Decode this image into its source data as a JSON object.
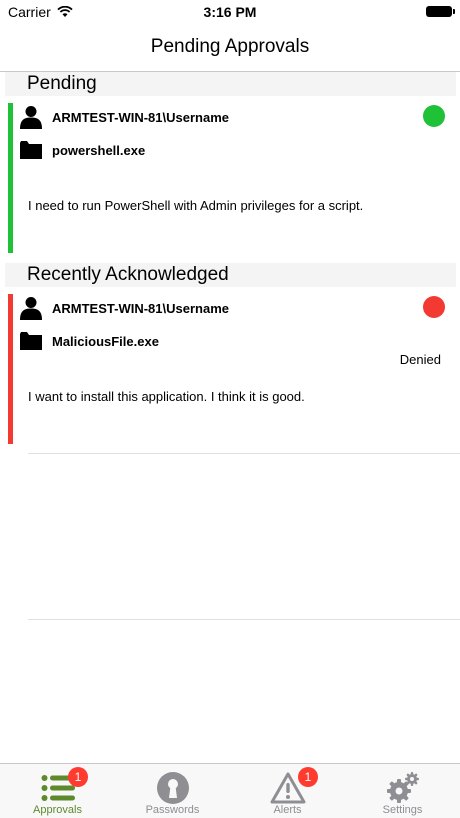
{
  "status_bar": {
    "carrier": "Carrier",
    "time": "3:16 PM"
  },
  "nav": {
    "title": "Pending Approvals"
  },
  "sections": {
    "pending": {
      "header": "Pending",
      "item": {
        "user": "ARMTEST-WIN-81\\Username",
        "file": "powershell.exe",
        "message": "I need to run PowerShell with Admin privileges for a script.",
        "status_color": "#1fc137",
        "bar_color": "#1fc137"
      }
    },
    "recent": {
      "header": "Recently Acknowledged",
      "item": {
        "user": "ARMTEST-WIN-81\\Username",
        "file": "MaliciousFile.exe",
        "status": "Denied",
        "message": "I want to install this application. I think it is good.",
        "status_color": "#f33a32",
        "bar_color": "#f33a32"
      }
    }
  },
  "tabs": [
    {
      "label": "Approvals",
      "icon": "list-icon",
      "badge": "1",
      "active": true
    },
    {
      "label": "Passwords",
      "icon": "keyhole-icon"
    },
    {
      "label": "Alerts",
      "icon": "warning-icon",
      "badge": "1"
    },
    {
      "label": "Settings",
      "icon": "gears-icon"
    }
  ],
  "colors": {
    "accent": "#5e8a2c",
    "badge": "#ff3b30",
    "inactive": "#8e8e93"
  }
}
